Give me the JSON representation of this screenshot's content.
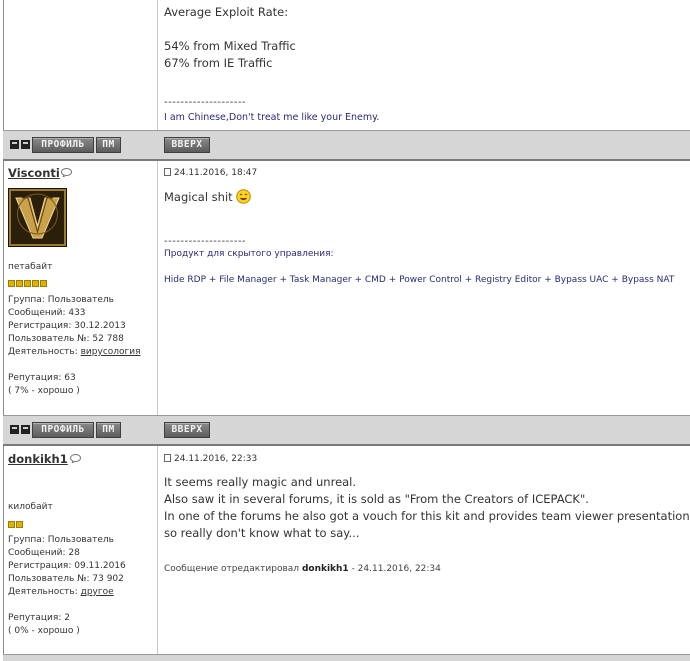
{
  "top_post": {
    "lines": [
      "Average Exploit Rate:",
      "54% from Mixed Traffic",
      "67% from IE Traffic"
    ],
    "signature_divider": "--------------------",
    "signature": "I am Chinese,Don't treat me like your Enemy."
  },
  "bars": {
    "profile_label": "ПРОФИЛЬ",
    "pm_label": "ПМ",
    "top_label": "ВВЕРХ"
  },
  "post1": {
    "username": "Visconti",
    "rank": "петабайт",
    "pips": 5,
    "date": "24.11.2016, 18:47",
    "text": "Magical shit",
    "signature_divider": "--------------------",
    "signature_line1": "Продукт для скрытого управления:",
    "signature_line2": "Hide RDP + File Manager + Task Manager + CMD + Power Control + Registry Editor + Bypass UAC + Bypass NAT",
    "info": {
      "group": "Группа: Пользователь",
      "posts": "Сообщений: 433",
      "registered": "Регистрация: 30.12.2013",
      "user_no": "Пользователь №: 52 788",
      "activity_label": "Деятельность:",
      "activity_value": "вирусология",
      "reputation": "Репутация: 63",
      "reputation_pct": "( 7% - хорошо )"
    }
  },
  "post2": {
    "username": "donkikh1",
    "rank": "килобайт",
    "pips": 2,
    "date": "24.11.2016, 22:33",
    "lines": [
      "It seems really magic and unreal.",
      "Also saw it in several forums, it is sold as \"From the Creators of ICEPACK\".",
      "In one of the forums he also got a vouch for this kit and provides team viewer presentation..",
      "so really don't know what to say..."
    ],
    "edited_prefix": "Сообщение отредактировал",
    "edited_user": "donkikh1",
    "edited_suffix": "- 24.11.2016, 22:34",
    "info": {
      "group": "Группа: Пользователь",
      "posts": "Сообщений: 28",
      "registered": "Регистрация: 09.11.2016",
      "user_no": "Пользователь №: 73 902",
      "activity_label": "Деятельность:",
      "activity_value": "другое",
      "reputation": "Репутация: 2",
      "reputation_pct": "( 0% - хорошо )"
    }
  },
  "colors": {
    "bar": "#d6d6d6",
    "pip": "#e2b200",
    "signature": "#2a2a7a"
  }
}
